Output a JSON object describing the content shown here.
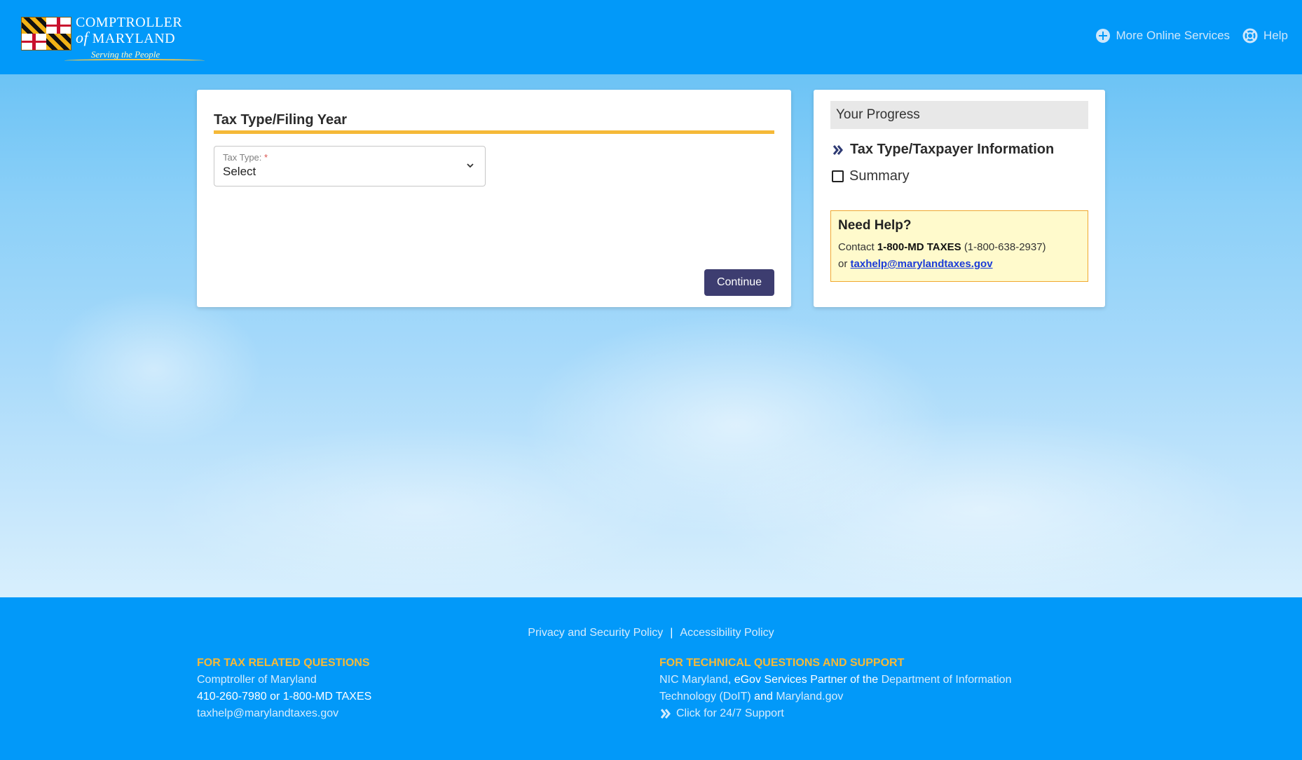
{
  "header": {
    "logo": {
      "line1": "COMPTROLLER",
      "line2_prefix": "of",
      "line2": "MARYLAND",
      "tagline": "Serving the People"
    },
    "nav": [
      {
        "label": "More Online Services",
        "icon": "plus-circle-icon"
      },
      {
        "label": "Help",
        "icon": "lifebuoy-icon"
      }
    ]
  },
  "main": {
    "section_title": "Tax Type/Filing Year",
    "tax_type": {
      "label": "Tax Type:",
      "required_mark": "*",
      "value": "Select"
    },
    "continue_label": "Continue"
  },
  "progress": {
    "title": "Your Progress",
    "steps": [
      {
        "label": "Tax Type/Taxpayer Information",
        "state": "current"
      },
      {
        "label": "Summary",
        "state": "pending"
      }
    ],
    "help": {
      "title": "Need Help?",
      "contact_prefix": "Contact",
      "phone_name": "1-800-MD TAXES",
      "phone_number": "(1-800-638-2937)",
      "or_text": "or",
      "email": "taxhelp@marylandtaxes.gov"
    }
  },
  "footer": {
    "links": [
      "Privacy and Security Policy",
      "Accessibility Policy"
    ],
    "separator": "|",
    "tax": {
      "heading": "FOR TAX RELATED QUESTIONS",
      "org": "Comptroller of Maryland",
      "phone": "410-260-7980 or 1-800-MD TAXES",
      "email": "taxhelp@marylandtaxes.gov"
    },
    "tech": {
      "heading": "FOR TECHNICAL QUESTIONS AND SUPPORT",
      "nic": "NIC Maryland",
      "partner_text": ", eGov Services Partner of the",
      "doit": "Department of Information Technology (DoIT)",
      "and_text": "and",
      "md_gov": "Maryland.gov",
      "support": "Click for 24/7 Support"
    }
  },
  "colors": {
    "brand_blue": "#0299f9",
    "accent_gold": "#f5b938",
    "button": "#3d3d70",
    "help_bg": "#fffacc"
  }
}
